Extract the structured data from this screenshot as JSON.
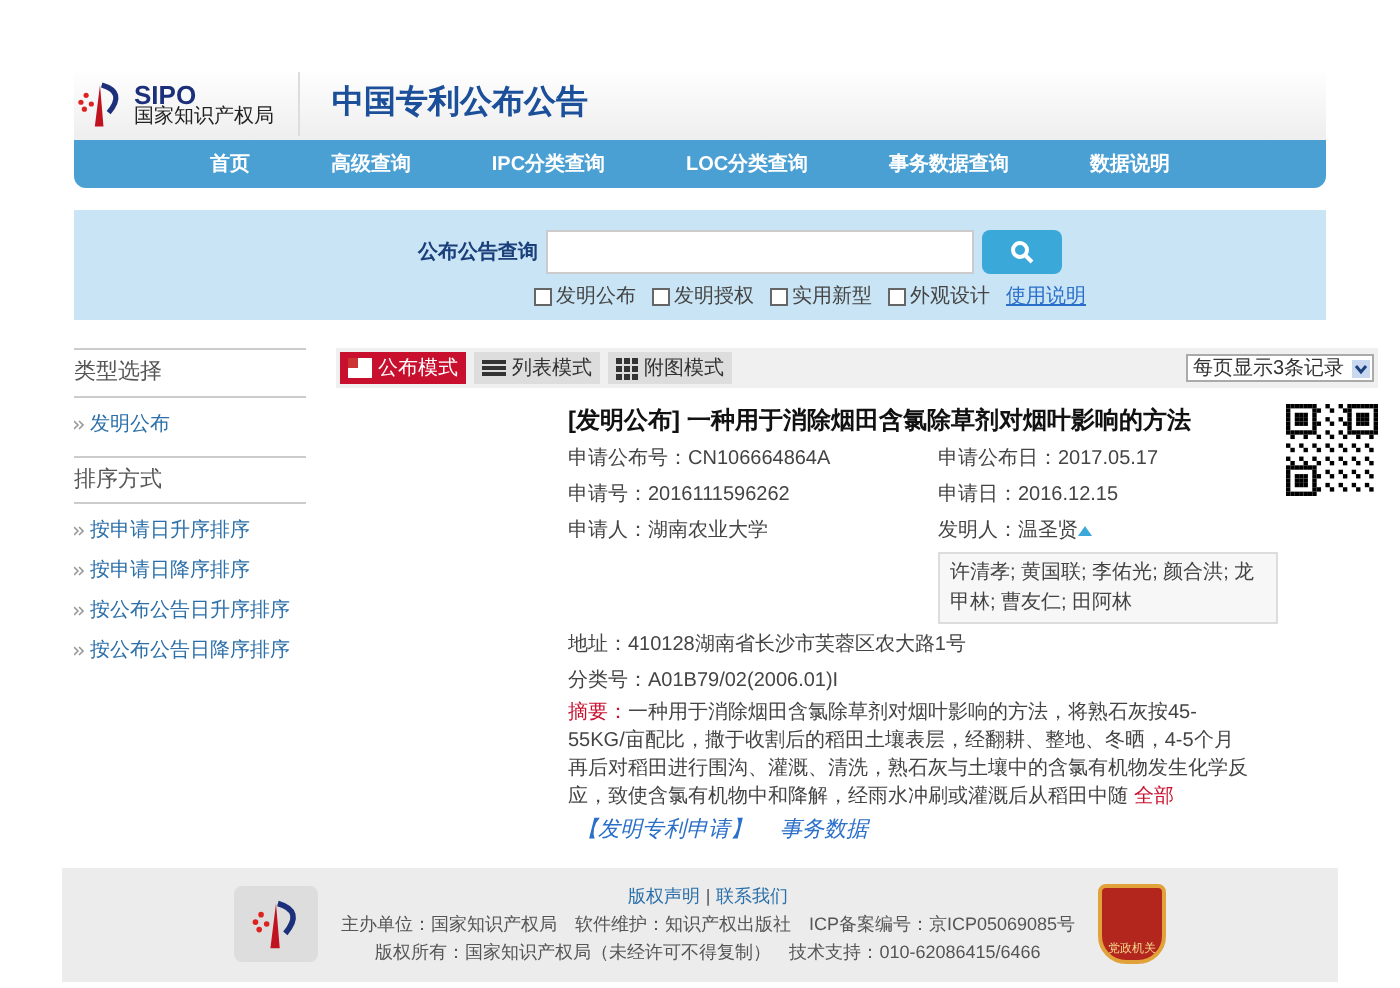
{
  "header": {
    "logo_text": "SIPO",
    "logo_subtext": "国家知识产权局",
    "title": "中国专利公布公告"
  },
  "nav": [
    {
      "label": "首页"
    },
    {
      "label": "高级查询"
    },
    {
      "label": "IPC分类查询"
    },
    {
      "label": "LOC分类查询"
    },
    {
      "label": "事务数据查询"
    },
    {
      "label": "数据说明"
    }
  ],
  "search": {
    "label": "公布公告查询",
    "options": [
      {
        "label": "发明公布",
        "checked": false
      },
      {
        "label": "发明授权",
        "checked": false
      },
      {
        "label": "实用新型",
        "checked": false
      },
      {
        "label": "外观设计",
        "checked": false
      }
    ],
    "help_link": "使用说明"
  },
  "sidebar": {
    "sections": [
      {
        "title": "类型选择",
        "items": [
          "发明公布"
        ]
      },
      {
        "title": "排序方式",
        "items": [
          "按申请日升序排序",
          "按申请日降序排序",
          "按公布公告日升序排序",
          "按公布公告日降序排序"
        ]
      }
    ]
  },
  "view_tabs": [
    {
      "label": "公布模式",
      "selected": true
    },
    {
      "label": "列表模式",
      "selected": false
    },
    {
      "label": "附图模式",
      "selected": false
    }
  ],
  "page_size": {
    "value": "每页显示3条记录"
  },
  "record": {
    "title": "[发明公布] 一种用于消除烟田含氯除草剂对烟叶影响的方法",
    "fields_left": [
      "申请公布号：CN106664864A",
      "申请号：2016111596262",
      "申请人：湖南农业大学"
    ],
    "fields_right": [
      "申请公布日：2017.05.17",
      "申请日：2016.12.15"
    ],
    "inventor": {
      "text": "发明人：温圣贤",
      "expanded": true,
      "more": "许清孝; 黄国联; 李佑光; 颜合洪; 龙甲林; 曹友仁; 田阿林"
    },
    "address": "地址：410128湖南省长沙市芙蓉区农大路1号",
    "classification": "分类号：A01B79/02(2006.01)I",
    "abstract_label": "摘要：",
    "abstract": "一种用于消除烟田含氯除草剂对烟叶影响的方法，将熟石灰按45-55KG/亩配比，撒于收割后的稻田土壤表层，经翻耕、整地、冬晒，4-5个月再后对稻田进行围沟、灌溉、清洗，熟石灰与土壤中的含氯有机物发生化学反应，致使含氯有机物中和降解，经雨水冲刷或灌溉后从稻田中随",
    "more_link": "全部",
    "links": [
      "【发明专利申请】",
      "事务数据"
    ]
  },
  "footer": {
    "links": [
      "版权声明",
      "联系我们"
    ],
    "separator": "|",
    "lines": [
      "主办单位：国家知识产权局　软件维护：知识产权出版社　ICP备案编号：京ICP05069085号",
      "版权所有：国家知识产权局（未经许可不得复制）　技术支持：010-62086415/6466"
    ],
    "badge_text": "党政机关"
  }
}
